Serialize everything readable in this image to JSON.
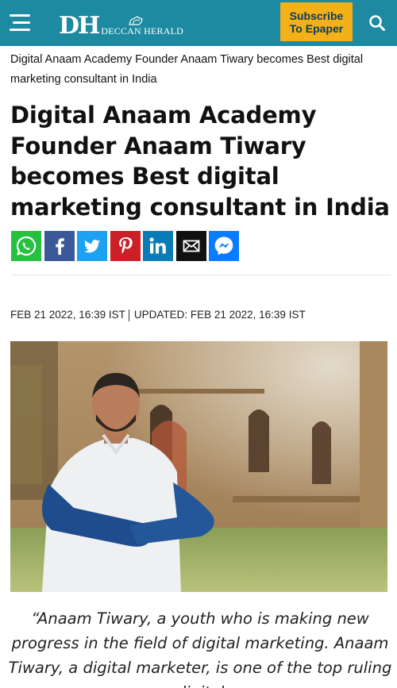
{
  "header": {
    "logo_mark": "DH",
    "logo_text": "DECCAN HERALD",
    "subscribe_line1": "Subscribe",
    "subscribe_line2": "To Epaper",
    "menu_icon": "hamburger-menu-icon",
    "search_icon": "search-icon",
    "colors": {
      "bar": "#1d8aa1",
      "subscribe_bg": "#f2b019",
      "subscribe_text": "#0d3b5e"
    }
  },
  "breadcrumb": "Digital Anaam Academy Founder Anaam Tiwary becomes Best digital marketing consultant in India",
  "article": {
    "headline": "Digital Anaam Academy Founder Anaam Tiwary becomes Best digital marketing consultant in India",
    "published": "FEB 21 2022, 16:39 IST",
    "updated": "UPDATED: FEB 21 2022, 16:39 IST",
    "quote": "“Anaam Tiwary, a youth who is making new progress in the field of digital marketing. Anaam Tiwary, a digital marketer, is one of the top ruling digital"
  },
  "share": [
    {
      "icon": "whatsapp-icon",
      "color": "#25c13f"
    },
    {
      "icon": "facebook-icon",
      "color": "#3b5998"
    },
    {
      "icon": "twitter-icon",
      "color": "#1da1f2"
    },
    {
      "icon": "pinterest-icon",
      "color": "#cb2027"
    },
    {
      "icon": "linkedin-icon",
      "color": "#0a7bb5"
    },
    {
      "icon": "email-icon",
      "color": "#111111"
    },
    {
      "icon": "messenger-icon",
      "color": "#0a7cff"
    }
  ]
}
